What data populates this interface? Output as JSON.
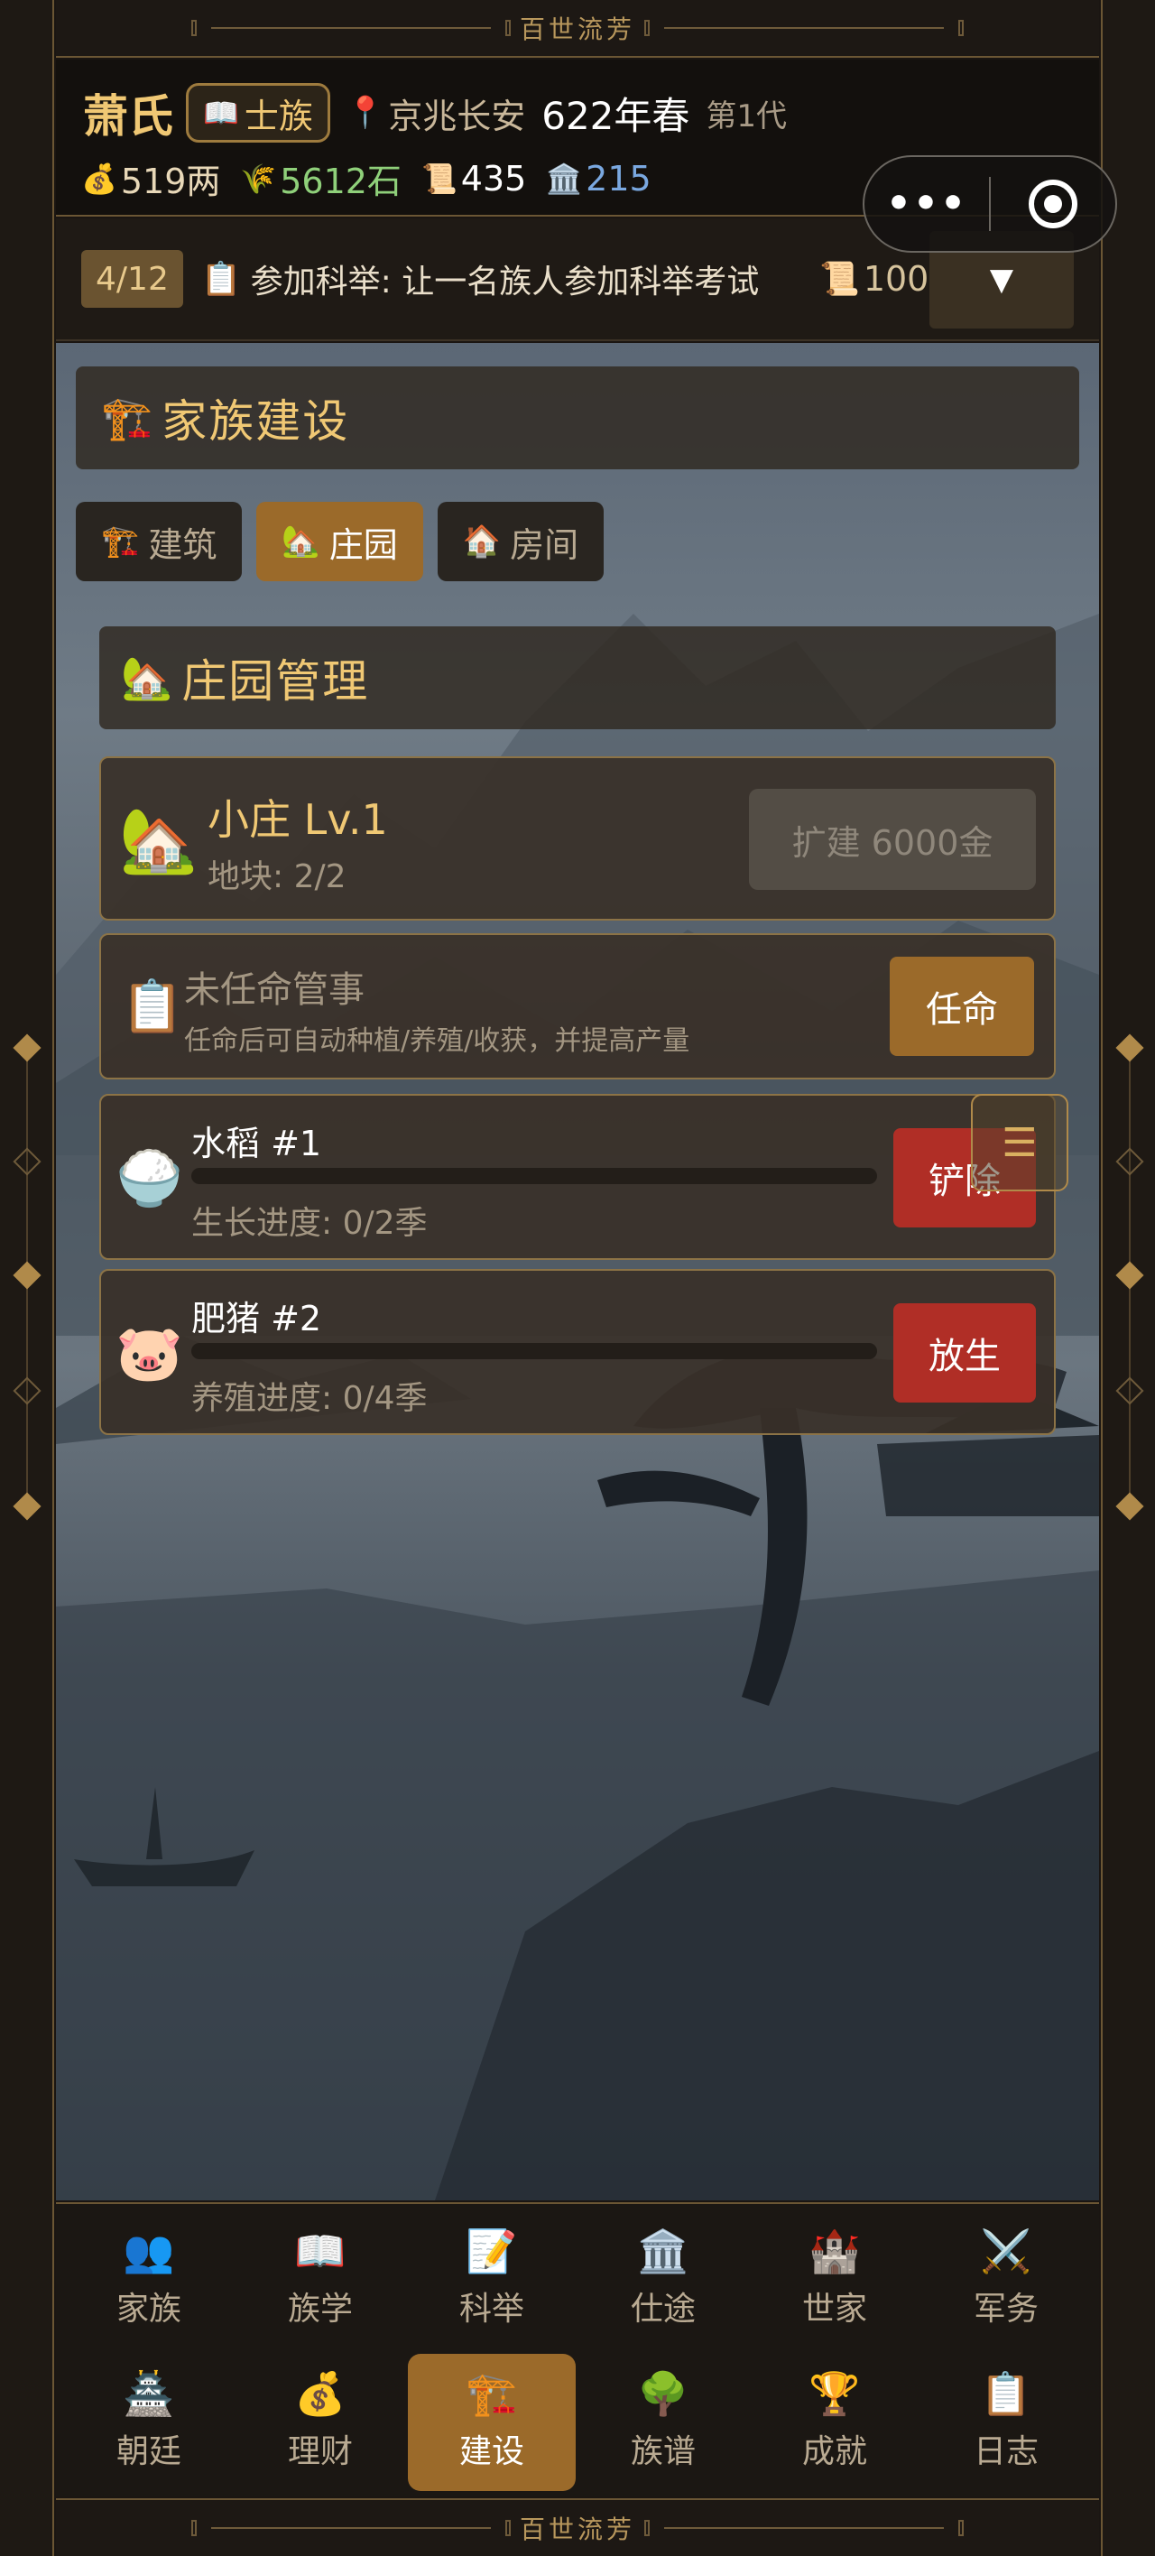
{
  "banner": {
    "title": "百世流芳"
  },
  "header": {
    "surname": "萧氏",
    "rank": {
      "icon": "📖",
      "label": "士族"
    },
    "location": {
      "icon": "📍",
      "label": "京兆长安"
    },
    "year": "622年春",
    "generation": "第1代",
    "resources": [
      {
        "icon": "💰",
        "value": "519两",
        "color": "#e8d8b8"
      },
      {
        "icon": "🌾",
        "value": "5612石",
        "color": "#8fd07a"
      },
      {
        "icon": "📜",
        "value": "435",
        "color": "#ffffff"
      },
      {
        "icon": "🏛️",
        "value": "215",
        "color": "#7aa8e0"
      }
    ]
  },
  "capsule": {
    "more_icon": "•••"
  },
  "quest": {
    "progress": "4/12",
    "icon": "📋",
    "text": "参加科举: 让一名族人参加科举考试",
    "reward_icon": "📜",
    "reward": "100",
    "toggle_icon": "▼"
  },
  "section": {
    "icon": "🏗️",
    "title": "家族建设"
  },
  "tabs": [
    {
      "icon": "🏗️",
      "label": "建筑",
      "active": false
    },
    {
      "icon": "🏡",
      "label": "庄园",
      "active": true
    },
    {
      "icon": "🏠",
      "label": "房间",
      "active": false
    }
  ],
  "estate_panel": {
    "icon": "🏡",
    "title": "庄园管理"
  },
  "estate": {
    "icon": "🏡",
    "name": "小庄 Lv.1",
    "plots": "地块: 2/2",
    "expand_label": "扩建 6000金"
  },
  "steward": {
    "icon": "📋",
    "title": "未任命管事",
    "desc": "任命后可自动种植/养殖/收获，并提高产量",
    "button": "任命"
  },
  "slots": [
    {
      "icon": "🍚",
      "name": "水稻 #1",
      "progress_label": "生长进度: 0/2季",
      "progress": 0,
      "button": "铲除"
    },
    {
      "icon": "🐷",
      "name": "肥猪 #2",
      "progress_label": "养殖进度: 0/4季",
      "progress": 0,
      "button": "放生"
    }
  ],
  "float_menu": {
    "icon": "☰"
  },
  "nav": [
    {
      "icon": "👥",
      "label": "家族",
      "active": false
    },
    {
      "icon": "📖",
      "label": "族学",
      "active": false
    },
    {
      "icon": "📝",
      "label": "科举",
      "active": false
    },
    {
      "icon": "🏛️",
      "label": "仕途",
      "active": false
    },
    {
      "icon": "🏰",
      "label": "世家",
      "active": false
    },
    {
      "icon": "⚔️",
      "label": "军务",
      "active": false
    },
    {
      "icon": "🏯",
      "label": "朝廷",
      "active": false
    },
    {
      "icon": "💰",
      "label": "理财",
      "active": false
    },
    {
      "icon": "🏗️",
      "label": "建设",
      "active": true
    },
    {
      "icon": "🌳",
      "label": "族谱",
      "active": false
    },
    {
      "icon": "🏆",
      "label": "成就",
      "active": false
    },
    {
      "icon": "📋",
      "label": "日志",
      "active": false
    }
  ]
}
